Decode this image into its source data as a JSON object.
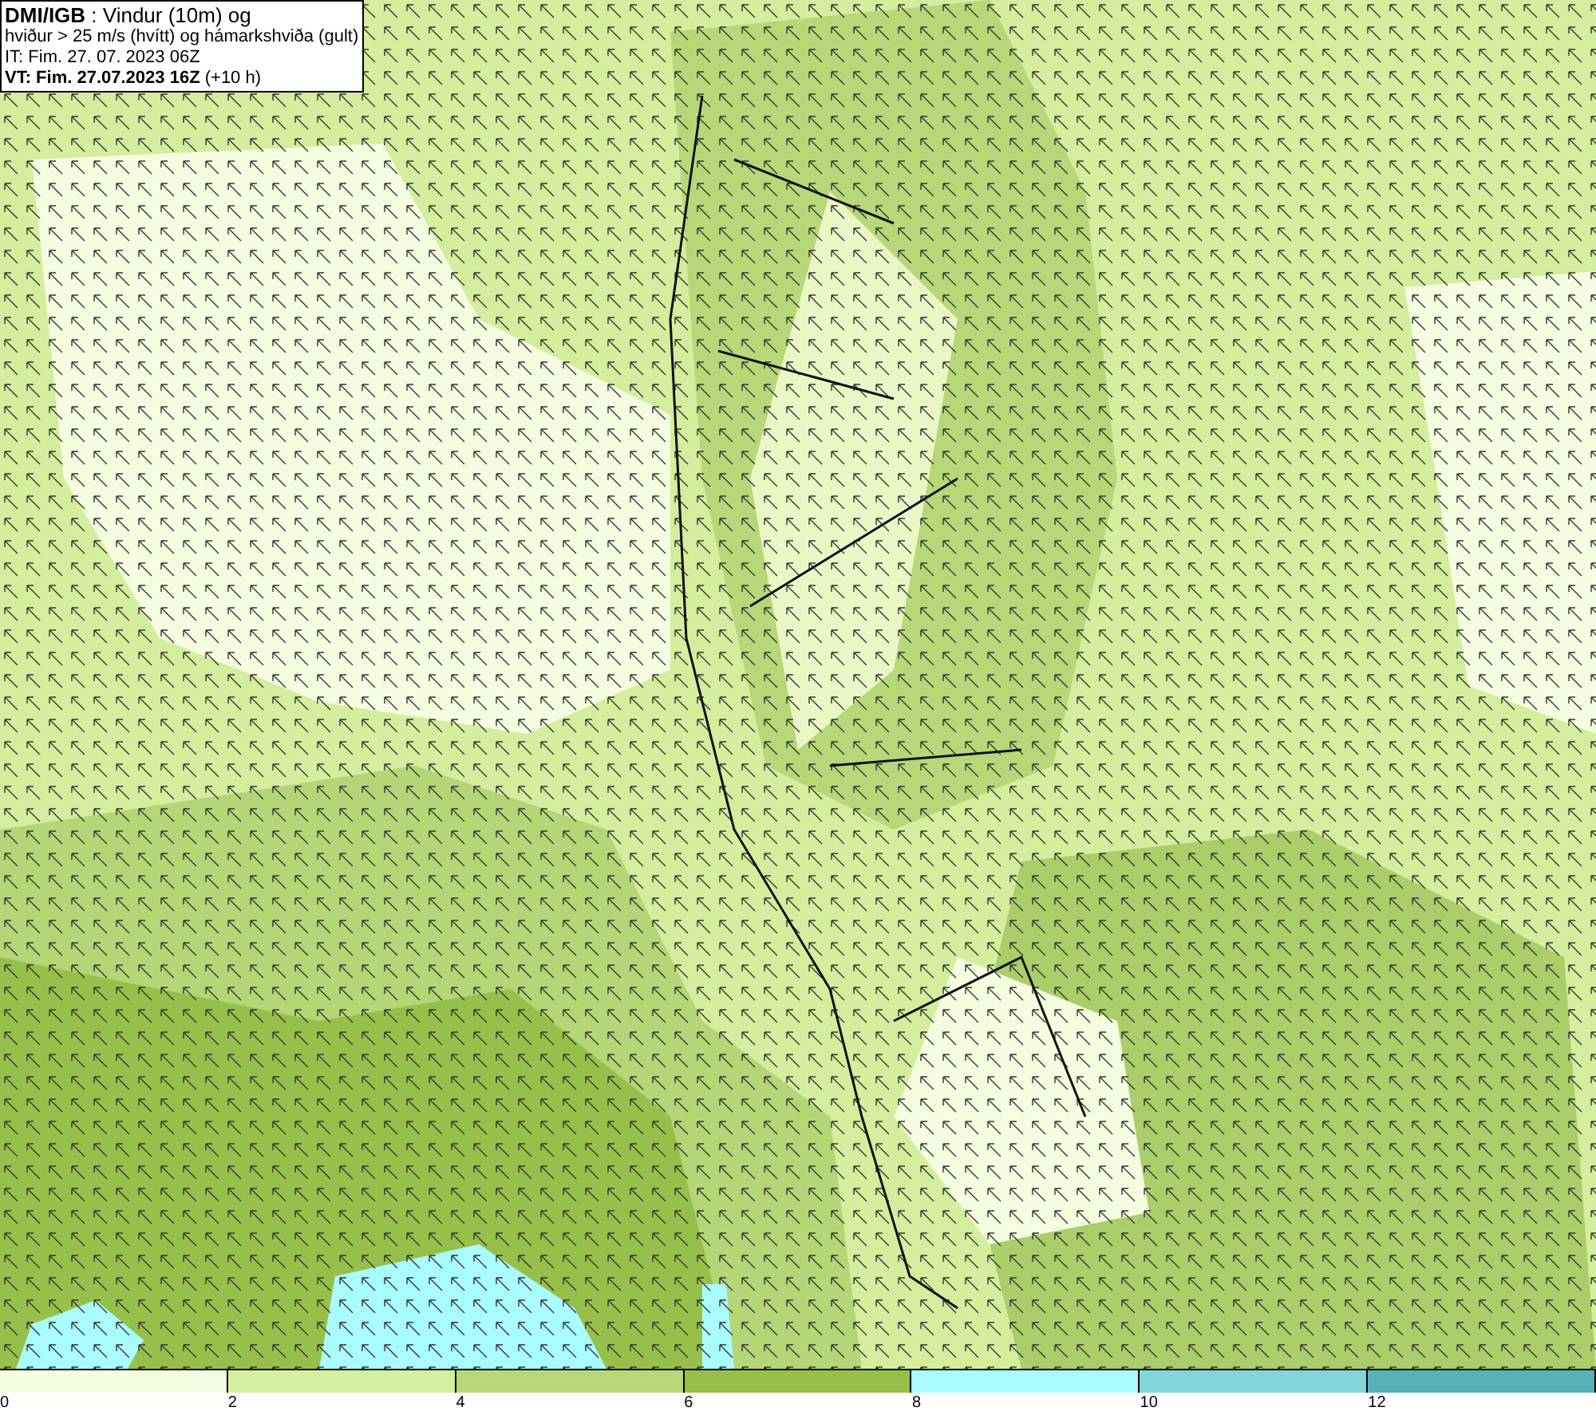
{
  "header": {
    "lines": [
      "**DMI/IGB** : Vindur (10m) og",
      "hviður > 25 m/s (hvítt) og hámarkshviða (gult)",
      "IT: Fim. 27. 07. 2023 06Z",
      "**VT: Fim. 27.07.2023 16Z** (+10 h)"
    ]
  },
  "legend": [
    {
      "label": "0",
      "color": "#f4fde0"
    },
    {
      "label": "2",
      "color": "#d5f0a0"
    },
    {
      "label": "4",
      "color": "#b6d878"
    },
    {
      "label": "6",
      "color": "#97c04a"
    },
    {
      "label": "8",
      "color": "#a8fbff"
    },
    {
      "label": "10",
      "color": "#80d6d8"
    },
    {
      "label": "12",
      "color": "#56b2b6"
    }
  ]
}
